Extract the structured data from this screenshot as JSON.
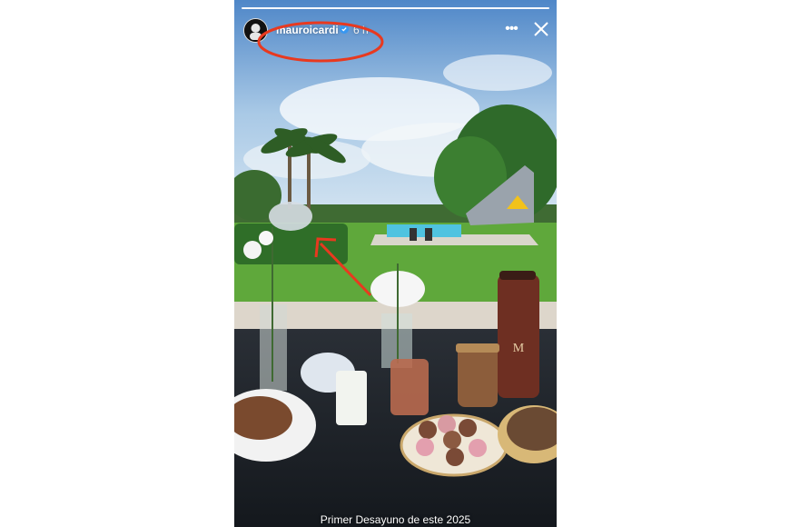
{
  "story": {
    "username": "mauroicardi",
    "time": "6 h",
    "caption": "Primer Desayuno de este 2025"
  },
  "icons": {
    "avatar": "profile-avatar",
    "verified": "verified-badge-icon",
    "more": "more-options-icon",
    "close": "close-icon"
  },
  "colors": {
    "annotation": "#e8391f",
    "sky": "#8fb7dc",
    "grass": "#5fa83b",
    "pool": "#4fc3e0"
  }
}
